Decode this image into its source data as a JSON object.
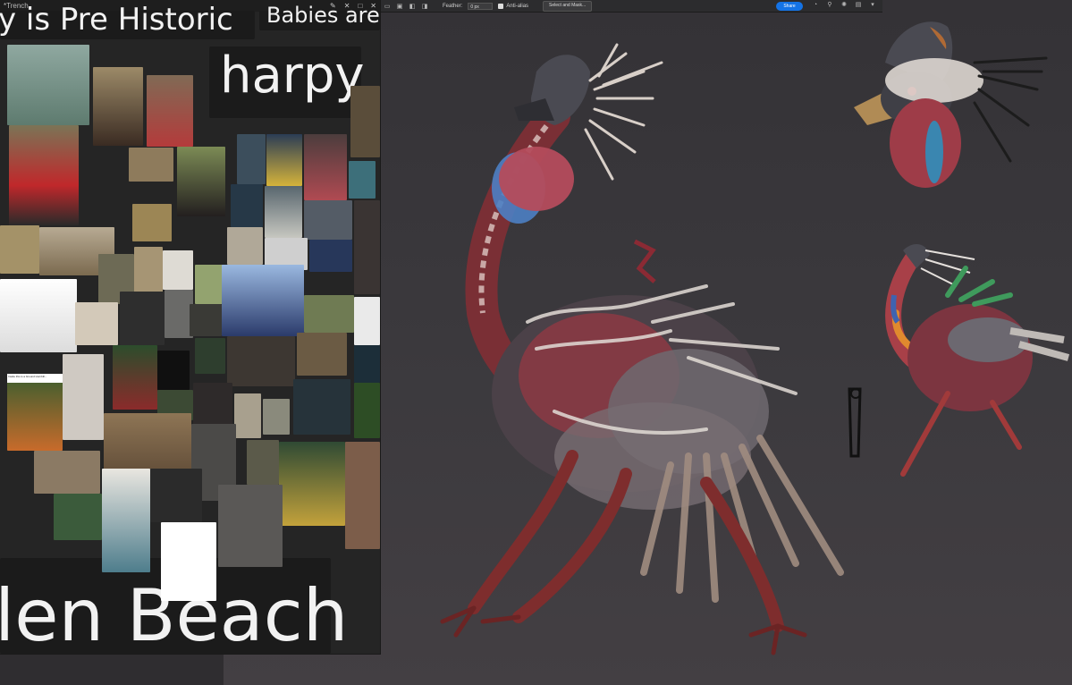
{
  "topbar": {
    "feather_label": "Feather:",
    "feather_value": "0 px",
    "antialias_label": "Anti-alias",
    "select_mask_label": "Select and Mask...",
    "share_label": "Share"
  },
  "ref_window": {
    "title": "*Trench",
    "controls": [
      "✕",
      "□",
      "✕"
    ],
    "texts": {
      "prehistoric": "y is Pre Historic",
      "babies": "Babies are",
      "harpy": "harpy",
      "beach": "len Beach"
    },
    "note": "Inside this is a Ground Hornbill..."
  },
  "colors": {
    "share_button": "#1473e6",
    "canvas_bg": "#3b393d",
    "ref_bg": "#252525"
  }
}
